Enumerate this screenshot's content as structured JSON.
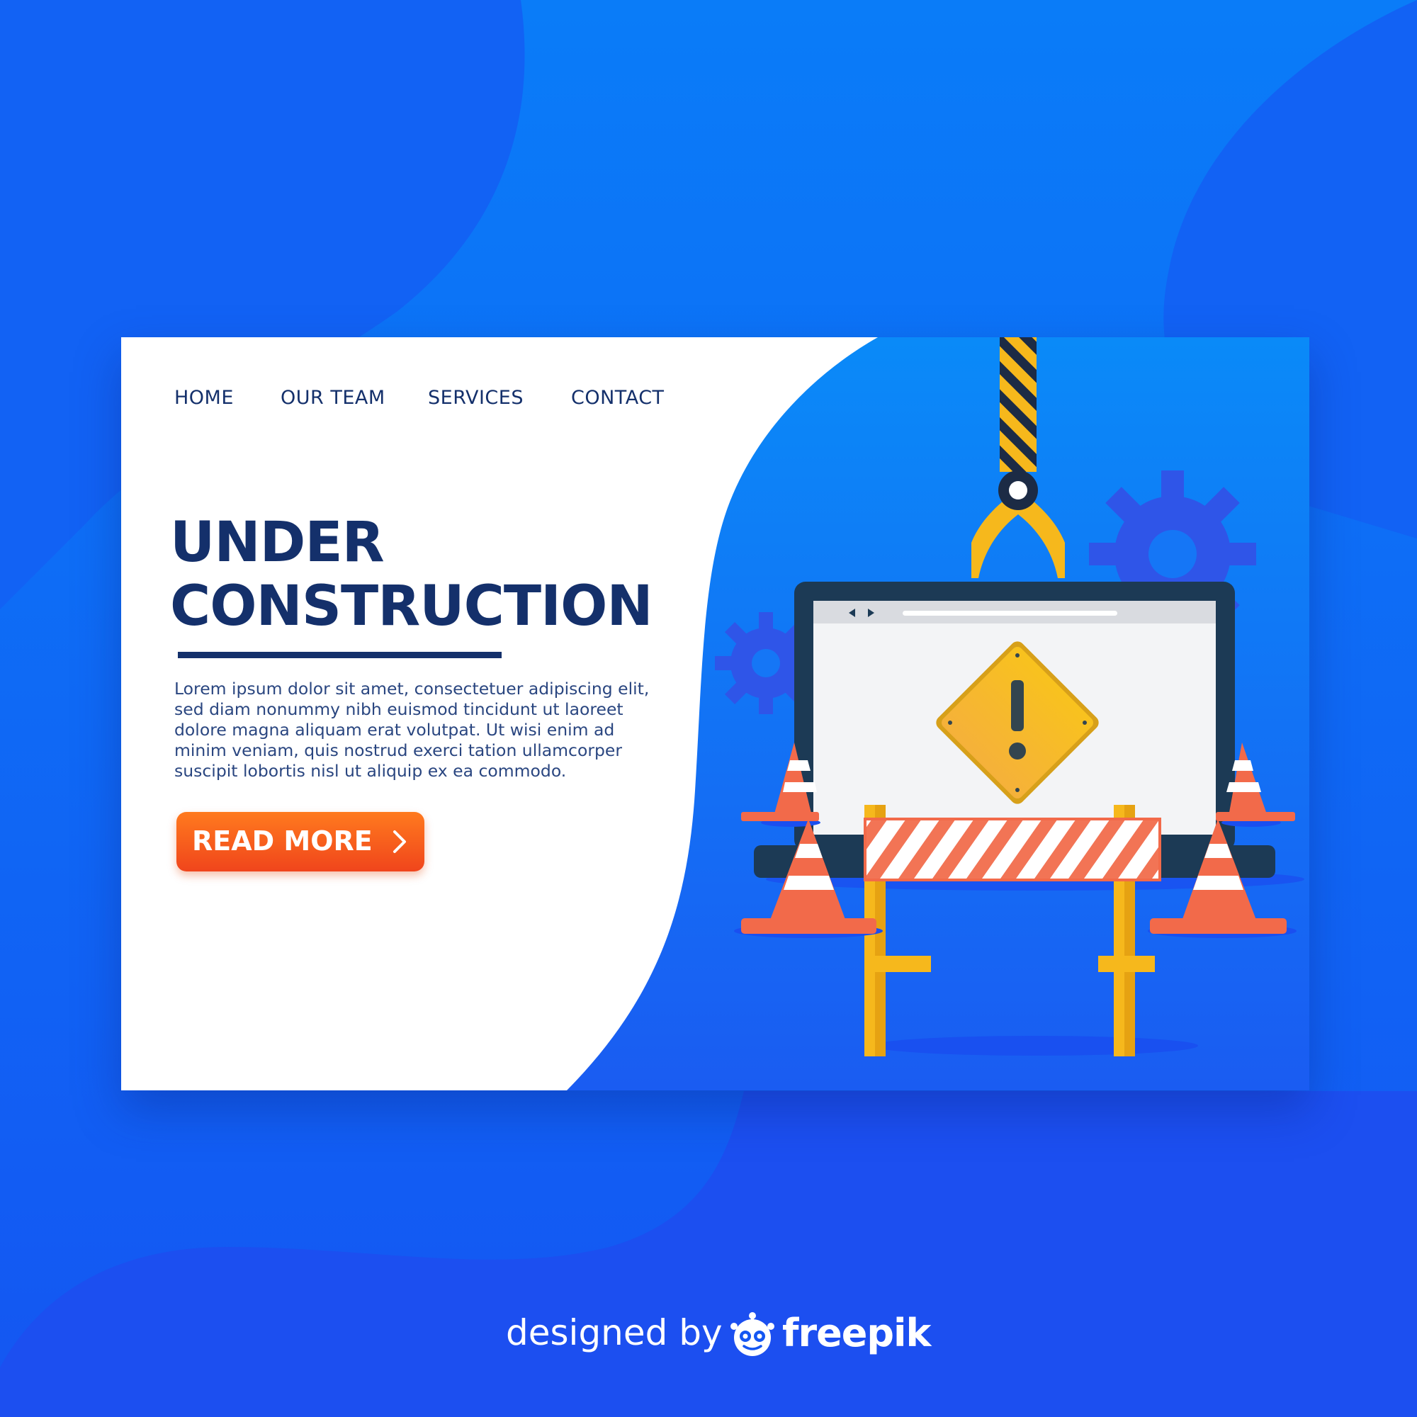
{
  "nav": {
    "items": [
      {
        "label": "HOME"
      },
      {
        "label": "OUR TEAM"
      },
      {
        "label": "SERVICES"
      },
      {
        "label": "CONTACT"
      }
    ]
  },
  "hero": {
    "title_line1": "UNDER",
    "title_line2": "CONSTRUCTION",
    "body": "Lorem ipsum dolor sit amet, consectetuer adipiscing elit, sed diam nonummy nibh euismod tincidunt ut laoreet dolore magna aliquam erat volutpat. Ut wisi enim ad minim veniam, quis nostrud exerci tation ullamcorper suscipit lobortis nisl ut aliquip ex ea commodo.",
    "cta_label": "READ MORE"
  },
  "illustration": {
    "icons": [
      "crane-hook-icon",
      "gear-icon",
      "laptop-icon",
      "warning-sign-icon",
      "traffic-cone-icon",
      "road-barrier-icon"
    ]
  },
  "footer": {
    "designed_by": "designed by",
    "brand": "freepik"
  },
  "colors": {
    "background": "#0b6ff6",
    "navy": "#14306b",
    "cta_orange": "#f4581d",
    "warning_yellow": "#f6b81c",
    "cone_orange": "#f26a4a",
    "gear_blue": "#2f55e8"
  }
}
